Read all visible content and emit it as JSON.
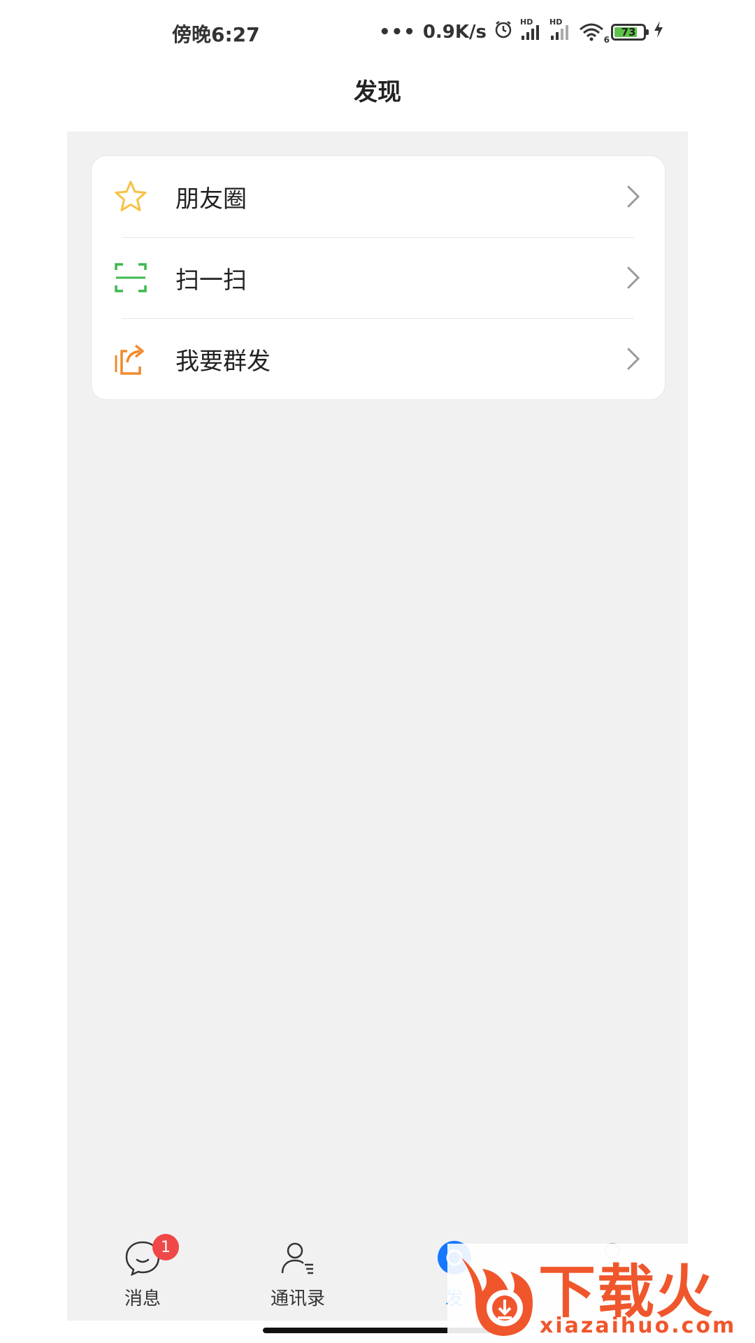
{
  "status_bar": {
    "time": "傍晚6:27",
    "network_speed": "0.9K/s",
    "hd_label_1": "HD",
    "hd_label_2": "HD",
    "wifi_sub": "6",
    "battery_level": "73",
    "battery_fraction": 0.73,
    "battery_color": "#5ec24a"
  },
  "header": {
    "title": "发现"
  },
  "menu": {
    "items": [
      {
        "label": "朋友圈",
        "icon": "star-icon",
        "color": "#f5c242"
      },
      {
        "label": "扫一扫",
        "icon": "scan-icon",
        "color": "#3cb94e"
      },
      {
        "label": "我要群发",
        "icon": "share-icon",
        "color": "#f08a2c"
      }
    ]
  },
  "bottom_nav": {
    "tabs": [
      {
        "label": "消息",
        "icon": "chat-bubble-icon",
        "badge": "1"
      },
      {
        "label": "通讯录",
        "icon": "contacts-icon"
      },
      {
        "label": "发",
        "icon": "discover-icon",
        "active": true
      },
      {
        "label": "",
        "icon": "profile-icon"
      }
    ],
    "active_color": "#1677ff"
  },
  "watermark": {
    "brand": "下载火",
    "url": "xiazaihuo.com"
  }
}
